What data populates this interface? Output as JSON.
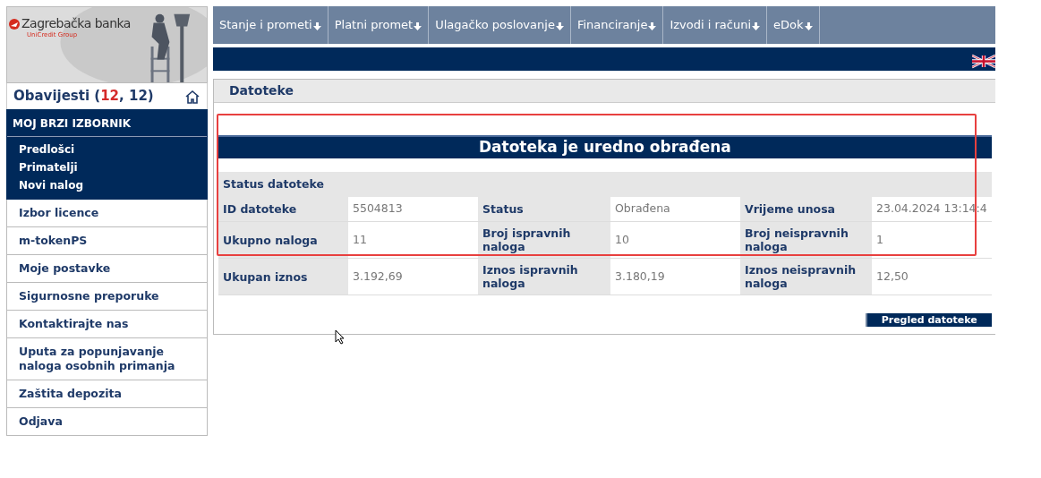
{
  "logo": {
    "brand": "Zagrebačka banka",
    "group": "UniCredit Group"
  },
  "notices": [
    {
      "text": "Obavijesti (",
      "highlight": false
    },
    {
      "text": "12",
      "highlight": true
    },
    {
      "text": ", 12)",
      "highlight": false
    }
  ],
  "quick_menu": {
    "title": "MOJ BRZI IZBORNIK",
    "items": [
      "Predlošci",
      "Primatelji",
      "Novi nalog"
    ]
  },
  "sidebar_items": [
    "Izbor licence",
    "m-tokenPS",
    "Moje postavke",
    "Sigurnosne preporuke",
    "Kontaktirajte nas",
    "Uputa za popunjavanje naloga osobnih primanja",
    "Zaštita depozita",
    "Odjava"
  ],
  "nav_tabs": [
    "Stanje i prometi",
    "Platni promet",
    "Ulagačko poslovanje",
    "Financiranje",
    "Izvodi i računi",
    "eDok"
  ],
  "page_title": "Datoteke",
  "result_banner": "Datoteka je uredno obrađena",
  "section_title": "Status datoteke",
  "rows": [
    [
      {
        "label": "ID datoteke",
        "value": "5504813"
      },
      {
        "label": "Status",
        "value": "Obrađena"
      },
      {
        "label": "Vrijeme unosa",
        "value": "23.04.2024 13:14:4"
      }
    ],
    [
      {
        "label": "Ukupno naloga",
        "value": "11"
      },
      {
        "label": "Broj ispravnih naloga",
        "value": "10"
      },
      {
        "label": "Broj neispravnih naloga",
        "value": "1"
      }
    ],
    [
      {
        "label": "Ukupan iznos",
        "value": "3.192,69"
      },
      {
        "label": "Iznos ispravnih naloga",
        "value": "3.180,19"
      },
      {
        "label": "Iznos neispravnih naloga",
        "value": "12,50"
      }
    ]
  ],
  "button": "Pregled datoteke"
}
